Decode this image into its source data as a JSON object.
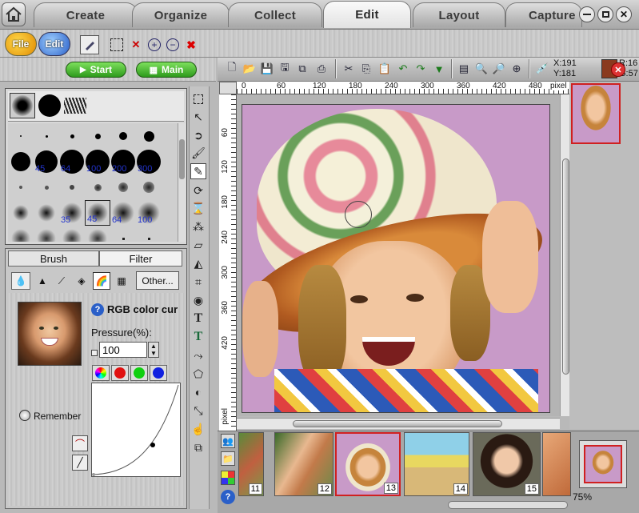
{
  "tabs": [
    "Create",
    "Organize",
    "Collect",
    "Edit",
    "Layout",
    "Capture"
  ],
  "active_tab": "Edit",
  "menu": {
    "file": "File",
    "edit": "Edit"
  },
  "nav": {
    "start": "Start",
    "main": "Main"
  },
  "coords": {
    "x": "X:191",
    "y": "Y:181"
  },
  "rgb_partial": {
    "r": "R:16",
    "g": "G:57"
  },
  "ruler": {
    "unit": "pixel",
    "ticks": [
      "0",
      "60",
      "120",
      "180",
      "240",
      "300",
      "360",
      "420",
      "480"
    ],
    "v_ticks": [
      "60",
      "120",
      "180",
      "240",
      "300",
      "360",
      "420"
    ],
    "corner_unit": "pixel"
  },
  "brush_sizes": [
    "45",
    "64",
    "100",
    "200",
    "300",
    "35",
    "45",
    "64",
    "100"
  ],
  "panel_tabs": {
    "brush": "Brush",
    "filter": "Filter"
  },
  "other_button": "Other...",
  "filter": {
    "name": "RGB color cur",
    "pressure_label": "Pressure(%):",
    "pressure_value": "100",
    "remember": "Remember"
  },
  "thumbnails": [
    "11",
    "12",
    "13",
    "14",
    "15"
  ],
  "zoom": "75%",
  "colors": {
    "accent_green": "#3fae2a",
    "selected_border": "#d02020",
    "ruler_bg": "#ffffff"
  }
}
